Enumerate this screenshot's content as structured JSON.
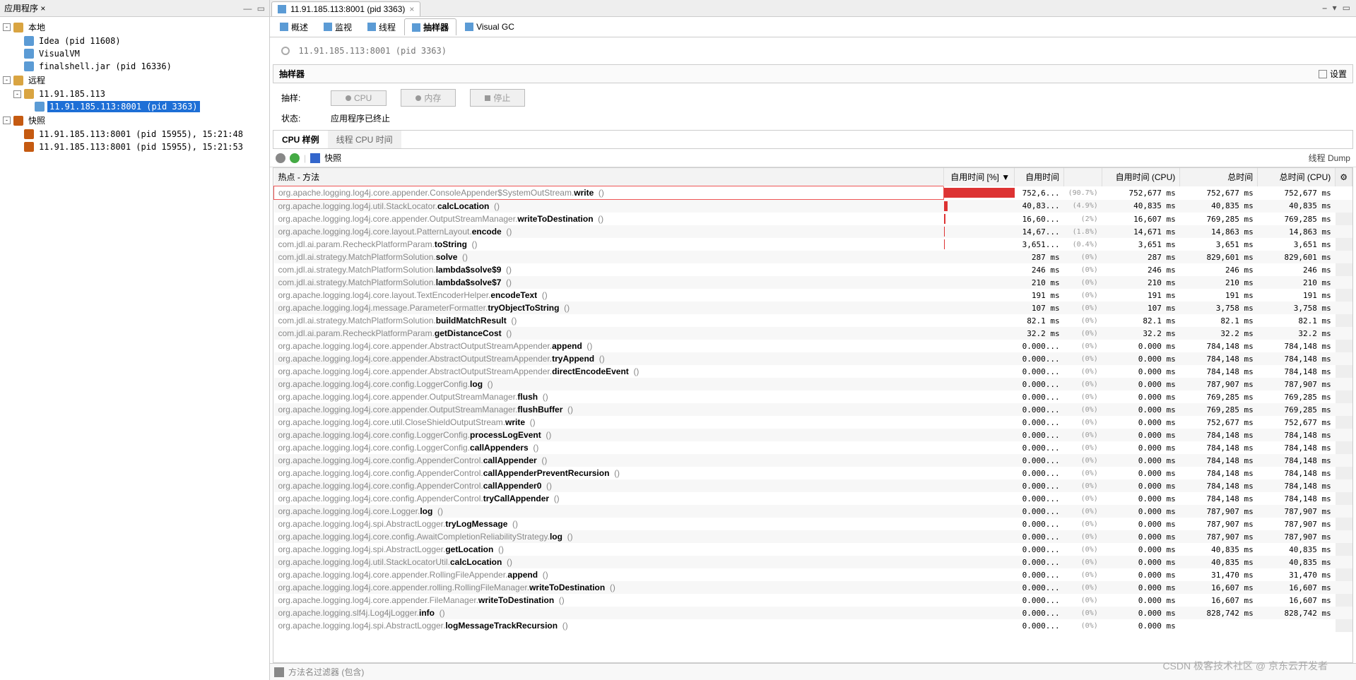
{
  "leftPanel": {
    "title": "应用程序 ×",
    "nodes": [
      {
        "indent": 0,
        "exp": "-",
        "icon": "host",
        "label": "本地"
      },
      {
        "indent": 1,
        "exp": "",
        "icon": "app",
        "label": "Idea (pid 11608)"
      },
      {
        "indent": 1,
        "exp": "",
        "icon": "app",
        "label": "VisualVM"
      },
      {
        "indent": 1,
        "exp": "",
        "icon": "app",
        "label": "finalshell.jar (pid 16336)"
      },
      {
        "indent": 0,
        "exp": "-",
        "icon": "host",
        "label": "远程"
      },
      {
        "indent": 1,
        "exp": "-",
        "icon": "host",
        "label": "11.91.185.113"
      },
      {
        "indent": 2,
        "exp": "",
        "icon": "app",
        "label": "11.91.185.113:8001 (pid 3363)",
        "sel": true
      },
      {
        "indent": 0,
        "exp": "-",
        "icon": "snap",
        "label": "快照"
      },
      {
        "indent": 1,
        "exp": "",
        "icon": "snap",
        "label": "11.91.185.113:8001 (pid 15955), 15:21:48"
      },
      {
        "indent": 1,
        "exp": "",
        "icon": "snap",
        "label": "11.91.185.113:8001 (pid 15955), 15:21:53"
      }
    ]
  },
  "tab": {
    "label": "11.91.185.113:8001 (pid 3363)"
  },
  "subtabs": [
    "概述",
    "监视",
    "线程",
    "抽样器",
    "Visual GC"
  ],
  "activeSubtab": 3,
  "pageTitle": "11.91.185.113:8001 (pid 3363)",
  "sectionHead": "抽样器",
  "settings": "设置",
  "sampleLbl": "抽样:",
  "cpuBtn": "CPU",
  "memBtn": "内存",
  "stopBtn": "停止",
  "statusLbl": "状态:",
  "statusVal": "应用程序已终止",
  "pillTabs": [
    "CPU 样例",
    "线程 CPU 时间"
  ],
  "snapshotLabel": "快照",
  "threadDump": "线程 Dump",
  "columns": [
    "热点 - 方法",
    "自用时间 [%] ▼",
    "自用时间",
    "",
    "自用时间 (CPU)",
    "总时间",
    "总时间 (CPU)"
  ],
  "rows": [
    {
      "pkg": "org.apache.logging.log4j.core.appender.ConsoleAppender$SystemOutStream.",
      "m": "write",
      "bar": 100,
      "t": "752,6...",
      "pct": "(90.7%)",
      "tcpu": "752,677 ms",
      "tot": "752,677 ms",
      "totcpu": "752,677 ms",
      "hl": true
    },
    {
      "pkg": "org.apache.logging.log4j.util.StackLocator.",
      "m": "calcLocation",
      "bar": 5,
      "t": "40,83...",
      "pct": "(4.9%)",
      "tcpu": "40,835 ms",
      "tot": "40,835 ms",
      "totcpu": "40,835 ms"
    },
    {
      "pkg": "org.apache.logging.log4j.core.appender.OutputStreamManager.",
      "m": "writeToDestination",
      "bar": 2,
      "t": "16,60...",
      "pct": "(2%)",
      "tcpu": "16,607 ms",
      "tot": "769,285 ms",
      "totcpu": "769,285 ms"
    },
    {
      "pkg": "org.apache.logging.log4j.core.layout.PatternLayout.",
      "m": "encode",
      "bar": 1.5,
      "t": "14,67...",
      "pct": "(1.8%)",
      "tcpu": "14,671 ms",
      "tot": "14,863 ms",
      "totcpu": "14,863 ms"
    },
    {
      "pkg": "com.jdl.ai.param.RecheckPlatformParam.",
      "m": "toString",
      "bar": 0.5,
      "t": "3,651...",
      "pct": "(0.4%)",
      "tcpu": "3,651 ms",
      "tot": "3,651 ms",
      "totcpu": "3,651 ms"
    },
    {
      "pkg": "com.jdl.ai.strategy.MatchPlatformSolution.",
      "m": "solve",
      "bar": 0,
      "t": "287 ms",
      "pct": "(0%)",
      "tcpu": "287 ms",
      "tot": "829,601 ms",
      "totcpu": "829,601 ms"
    },
    {
      "pkg": "com.jdl.ai.strategy.MatchPlatformSolution.",
      "m": "lambda$solve$9",
      "bar": 0,
      "t": "246 ms",
      "pct": "(0%)",
      "tcpu": "246 ms",
      "tot": "246 ms",
      "totcpu": "246 ms"
    },
    {
      "pkg": "com.jdl.ai.strategy.MatchPlatformSolution.",
      "m": "lambda$solve$7",
      "bar": 0,
      "t": "210 ms",
      "pct": "(0%)",
      "tcpu": "210 ms",
      "tot": "210 ms",
      "totcpu": "210 ms"
    },
    {
      "pkg": "org.apache.logging.log4j.core.layout.TextEncoderHelper.",
      "m": "encodeText",
      "bar": 0,
      "t": "191 ms",
      "pct": "(0%)",
      "tcpu": "191 ms",
      "tot": "191 ms",
      "totcpu": "191 ms"
    },
    {
      "pkg": "org.apache.logging.log4j.message.ParameterFormatter.",
      "m": "tryObjectToString",
      "bar": 0,
      "t": "107 ms",
      "pct": "(0%)",
      "tcpu": "107 ms",
      "tot": "3,758 ms",
      "totcpu": "3,758 ms"
    },
    {
      "pkg": "com.jdl.ai.strategy.MatchPlatformSolution.",
      "m": "buildMatchResult",
      "bar": 0,
      "t": "82.1 ms",
      "pct": "(0%)",
      "tcpu": "82.1 ms",
      "tot": "82.1 ms",
      "totcpu": "82.1 ms"
    },
    {
      "pkg": "com.jdl.ai.param.RecheckPlatformParam.",
      "m": "getDistanceCost",
      "bar": 0,
      "t": "32.2 ms",
      "pct": "(0%)",
      "tcpu": "32.2 ms",
      "tot": "32.2 ms",
      "totcpu": "32.2 ms"
    },
    {
      "pkg": "org.apache.logging.log4j.core.appender.AbstractOutputStreamAppender.",
      "m": "append",
      "bar": 0,
      "t": "0.000...",
      "pct": "(0%)",
      "tcpu": "0.000 ms",
      "tot": "784,148 ms",
      "totcpu": "784,148 ms"
    },
    {
      "pkg": "org.apache.logging.log4j.core.appender.AbstractOutputStreamAppender.",
      "m": "tryAppend",
      "bar": 0,
      "t": "0.000...",
      "pct": "(0%)",
      "tcpu": "0.000 ms",
      "tot": "784,148 ms",
      "totcpu": "784,148 ms"
    },
    {
      "pkg": "org.apache.logging.log4j.core.appender.AbstractOutputStreamAppender.",
      "m": "directEncodeEvent",
      "bar": 0,
      "t": "0.000...",
      "pct": "(0%)",
      "tcpu": "0.000 ms",
      "tot": "784,148 ms",
      "totcpu": "784,148 ms"
    },
    {
      "pkg": "org.apache.logging.log4j.core.config.LoggerConfig.",
      "m": "log",
      "bar": 0,
      "t": "0.000...",
      "pct": "(0%)",
      "tcpu": "0.000 ms",
      "tot": "787,907 ms",
      "totcpu": "787,907 ms"
    },
    {
      "pkg": "org.apache.logging.log4j.core.appender.OutputStreamManager.",
      "m": "flush",
      "bar": 0,
      "t": "0.000...",
      "pct": "(0%)",
      "tcpu": "0.000 ms",
      "tot": "769,285 ms",
      "totcpu": "769,285 ms"
    },
    {
      "pkg": "org.apache.logging.log4j.core.appender.OutputStreamManager.",
      "m": "flushBuffer",
      "bar": 0,
      "t": "0.000...",
      "pct": "(0%)",
      "tcpu": "0.000 ms",
      "tot": "769,285 ms",
      "totcpu": "769,285 ms"
    },
    {
      "pkg": "org.apache.logging.log4j.core.util.CloseShieldOutputStream.",
      "m": "write",
      "bar": 0,
      "t": "0.000...",
      "pct": "(0%)",
      "tcpu": "0.000 ms",
      "tot": "752,677 ms",
      "totcpu": "752,677 ms"
    },
    {
      "pkg": "org.apache.logging.log4j.core.config.LoggerConfig.",
      "m": "processLogEvent",
      "bar": 0,
      "t": "0.000...",
      "pct": "(0%)",
      "tcpu": "0.000 ms",
      "tot": "784,148 ms",
      "totcpu": "784,148 ms"
    },
    {
      "pkg": "org.apache.logging.log4j.core.config.LoggerConfig.",
      "m": "callAppenders",
      "bar": 0,
      "t": "0.000...",
      "pct": "(0%)",
      "tcpu": "0.000 ms",
      "tot": "784,148 ms",
      "totcpu": "784,148 ms"
    },
    {
      "pkg": "org.apache.logging.log4j.core.config.AppenderControl.",
      "m": "callAppender",
      "bar": 0,
      "t": "0.000...",
      "pct": "(0%)",
      "tcpu": "0.000 ms",
      "tot": "784,148 ms",
      "totcpu": "784,148 ms"
    },
    {
      "pkg": "org.apache.logging.log4j.core.config.AppenderControl.",
      "m": "callAppenderPreventRecursion",
      "bar": 0,
      "t": "0.000...",
      "pct": "(0%)",
      "tcpu": "0.000 ms",
      "tot": "784,148 ms",
      "totcpu": "784,148 ms"
    },
    {
      "pkg": "org.apache.logging.log4j.core.config.AppenderControl.",
      "m": "callAppender0",
      "bar": 0,
      "t": "0.000...",
      "pct": "(0%)",
      "tcpu": "0.000 ms",
      "tot": "784,148 ms",
      "totcpu": "784,148 ms"
    },
    {
      "pkg": "org.apache.logging.log4j.core.config.AppenderControl.",
      "m": "tryCallAppender",
      "bar": 0,
      "t": "0.000...",
      "pct": "(0%)",
      "tcpu": "0.000 ms",
      "tot": "784,148 ms",
      "totcpu": "784,148 ms"
    },
    {
      "pkg": "org.apache.logging.log4j.core.Logger.",
      "m": "log",
      "bar": 0,
      "t": "0.000...",
      "pct": "(0%)",
      "tcpu": "0.000 ms",
      "tot": "787,907 ms",
      "totcpu": "787,907 ms"
    },
    {
      "pkg": "org.apache.logging.log4j.spi.AbstractLogger.",
      "m": "tryLogMessage",
      "bar": 0,
      "t": "0.000...",
      "pct": "(0%)",
      "tcpu": "0.000 ms",
      "tot": "787,907 ms",
      "totcpu": "787,907 ms"
    },
    {
      "pkg": "org.apache.logging.log4j.core.config.AwaitCompletionReliabilityStrategy.",
      "m": "log",
      "bar": 0,
      "t": "0.000...",
      "pct": "(0%)",
      "tcpu": "0.000 ms",
      "tot": "787,907 ms",
      "totcpu": "787,907 ms"
    },
    {
      "pkg": "org.apache.logging.log4j.spi.AbstractLogger.",
      "m": "getLocation",
      "bar": 0,
      "t": "0.000...",
      "pct": "(0%)",
      "tcpu": "0.000 ms",
      "tot": "40,835 ms",
      "totcpu": "40,835 ms"
    },
    {
      "pkg": "org.apache.logging.log4j.util.StackLocatorUtil.",
      "m": "calcLocation",
      "bar": 0,
      "t": "0.000...",
      "pct": "(0%)",
      "tcpu": "0.000 ms",
      "tot": "40,835 ms",
      "totcpu": "40,835 ms"
    },
    {
      "pkg": "org.apache.logging.log4j.core.appender.RollingFileAppender.",
      "m": "append",
      "bar": 0,
      "t": "0.000...",
      "pct": "(0%)",
      "tcpu": "0.000 ms",
      "tot": "31,470 ms",
      "totcpu": "31,470 ms"
    },
    {
      "pkg": "org.apache.logging.log4j.core.appender.rolling.RollingFileManager.",
      "m": "writeToDestination",
      "bar": 0,
      "t": "0.000...",
      "pct": "(0%)",
      "tcpu": "0.000 ms",
      "tot": "16,607 ms",
      "totcpu": "16,607 ms"
    },
    {
      "pkg": "org.apache.logging.log4j.core.appender.FileManager.",
      "m": "writeToDestination",
      "bar": 0,
      "t": "0.000...",
      "pct": "(0%)",
      "tcpu": "0.000 ms",
      "tot": "16,607 ms",
      "totcpu": "16,607 ms"
    },
    {
      "pkg": "org.apache.logging.slf4j.Log4jLogger.",
      "m": "info",
      "bar": 0,
      "t": "0.000...",
      "pct": "(0%)",
      "tcpu": "0.000 ms",
      "tot": "828,742 ms",
      "totcpu": "828,742 ms"
    },
    {
      "pkg": "org.apache.logging.log4j.spi.AbstractLogger.",
      "m": "logMessageTrackRecursion",
      "bar": 0,
      "t": "0.000...",
      "pct": "(0%)",
      "tcpu": "0.000 ms",
      "tot": "",
      "totcpu": ""
    }
  ],
  "filterLabel": "方法名过滤器 (包含)",
  "watermark": "CSDN 极客技术社区 @ 京东云开发者"
}
